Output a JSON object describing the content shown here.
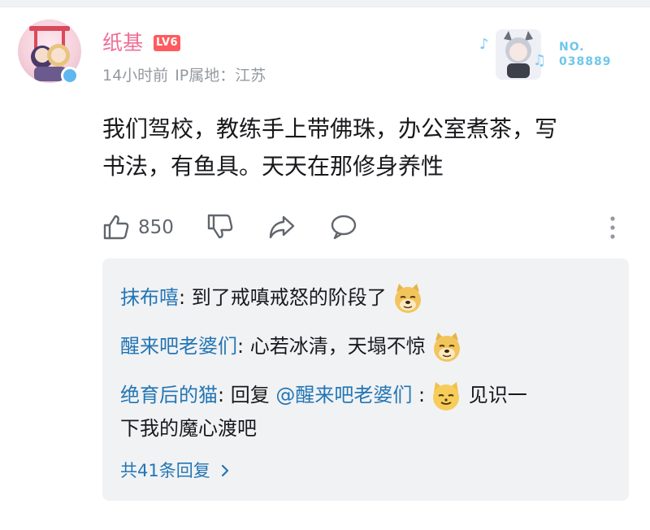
{
  "user": {
    "name": "纸基",
    "level_badge": "LV6",
    "time": "14小时前",
    "ip_location": "IP属地：江苏",
    "name_color": "#ef6f98"
  },
  "fan_card": {
    "label": "NO.",
    "number": "038889"
  },
  "comment": {
    "line1": "我们驾校，教练手上带佛珠，办公室煮茶，写",
    "line2": "书法，有鱼具。天天在那修身养性"
  },
  "actions": {
    "like_count": "850",
    "like_icon": "thumbs-up-icon",
    "dislike_icon": "thumbs-down-icon",
    "share_icon": "share-icon",
    "reply_icon": "comment-bubble-icon",
    "more_icon": "more-vertical-icon"
  },
  "replies": {
    "items": [
      {
        "name": "抹布嘻",
        "sep": ": ",
        "text": "到了戒嗔戒怒的阶段了",
        "emoji": "doge-emoji"
      },
      {
        "name": "醒来吧老婆们",
        "sep": ": ",
        "text": "心若冰清，天塌不惊",
        "emoji": "doge-emoji"
      },
      {
        "name": "绝育后的猫",
        "sep": ": ",
        "prefix": "回复 ",
        "mention": "@醒来吧老婆们",
        "mention_sep": " :",
        "text_a": "见识一",
        "text_b": "下我的魔心渡吧",
        "emoji": "cat-emoji"
      }
    ],
    "total": "共41条回复",
    "link_color": "#2476b4"
  }
}
